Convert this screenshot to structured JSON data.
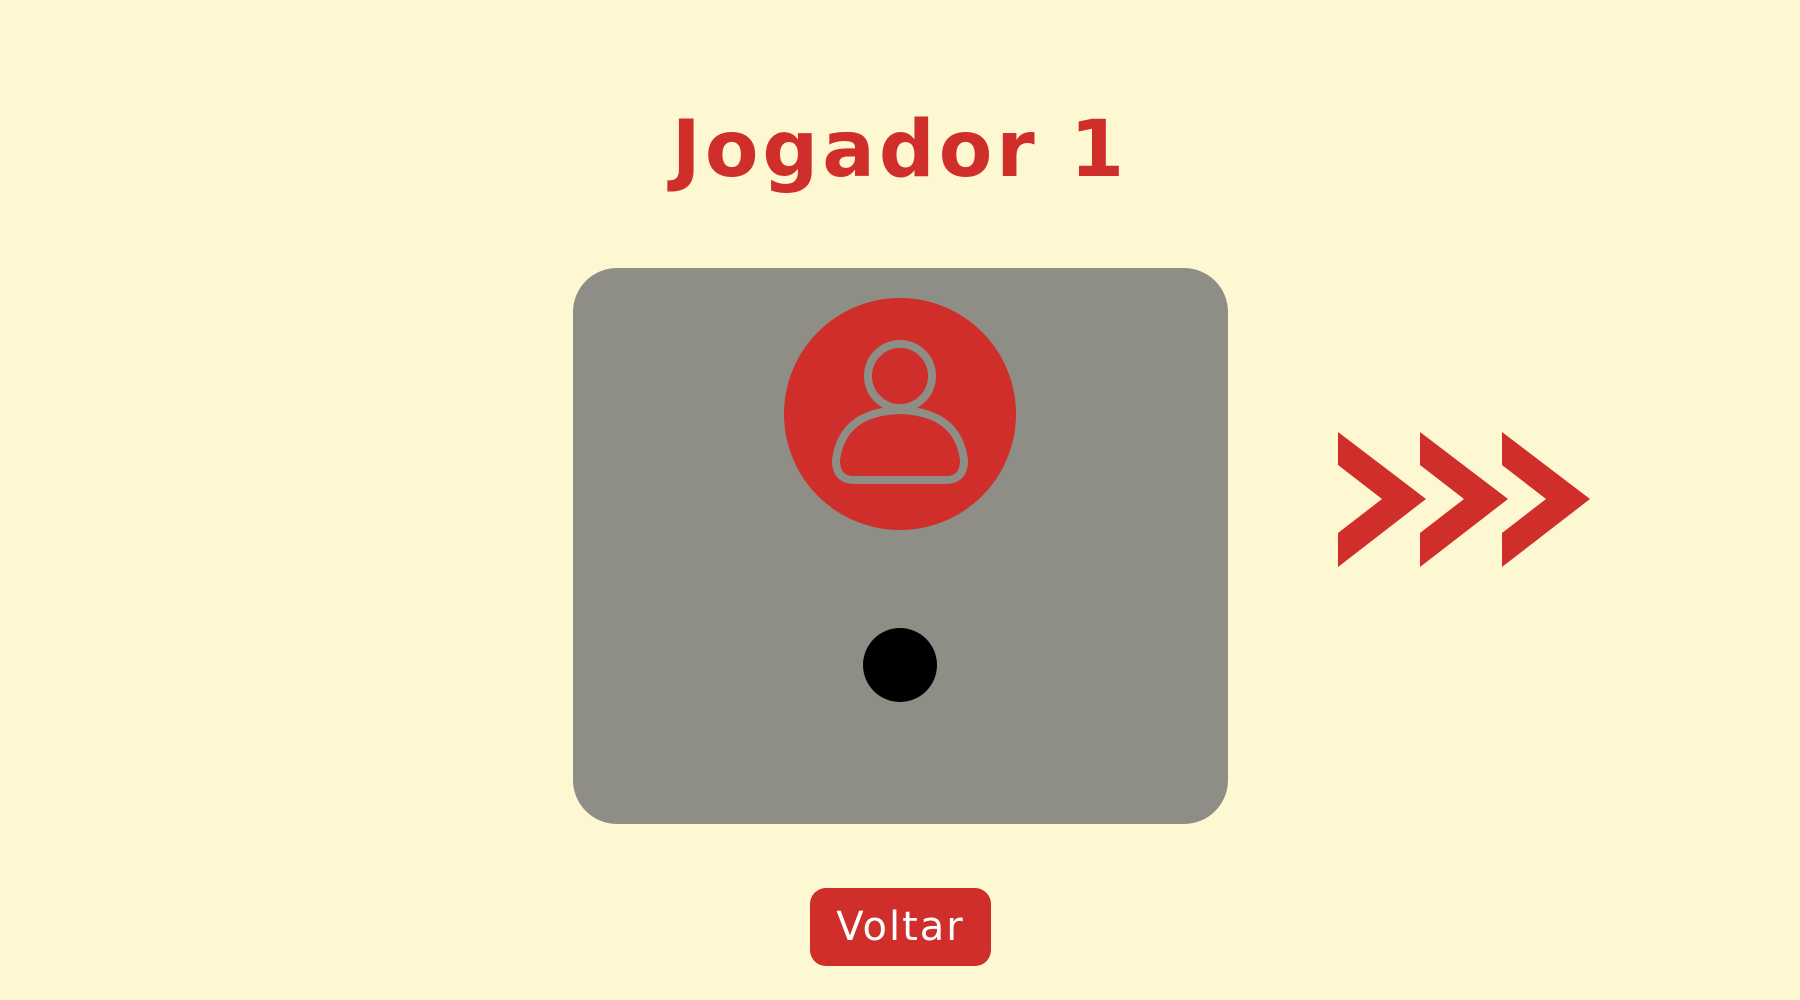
{
  "title": "Jogador 1",
  "player_card": {
    "avatar_icon": "user-icon"
  },
  "next_icon": "triple-chevron-right-icon",
  "back_button_label": "Voltar",
  "colors": {
    "background": "#fef8d2",
    "accent": "#cf2e2a",
    "card": "#8e8e86",
    "indicator": "#000000",
    "button_text": "#ffffff"
  }
}
